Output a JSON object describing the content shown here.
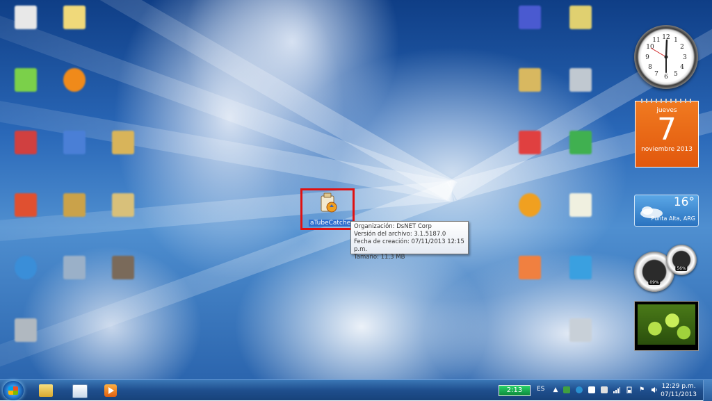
{
  "selected_icon": {
    "label": "aTubeCatcher"
  },
  "tooltip": {
    "lines": [
      "Organización: DsNET Corp",
      "Versión del archivo: 3.1.5187.0",
      "Fecha de creación: 07/11/2013 12:15 p.m.",
      "Tamaño: 11,3 MB"
    ]
  },
  "gadgets": {
    "calendar": {
      "weekday": "jueves",
      "day": "7",
      "month_year": "noviembre 2013"
    },
    "weather": {
      "temp": "16°",
      "location": "Punta Alta, ARG"
    },
    "cpu_meter": {
      "cpu": "09%",
      "memory": "56%"
    }
  },
  "taskbar": {
    "battery_timer": "2:13",
    "language": "ES",
    "time": "12:29 p.m.",
    "date": "07/11/2013"
  },
  "colors": {
    "selection_highlight": "#e01010",
    "taskbar": "#1f4f8e",
    "calendar": "#e2580d"
  }
}
